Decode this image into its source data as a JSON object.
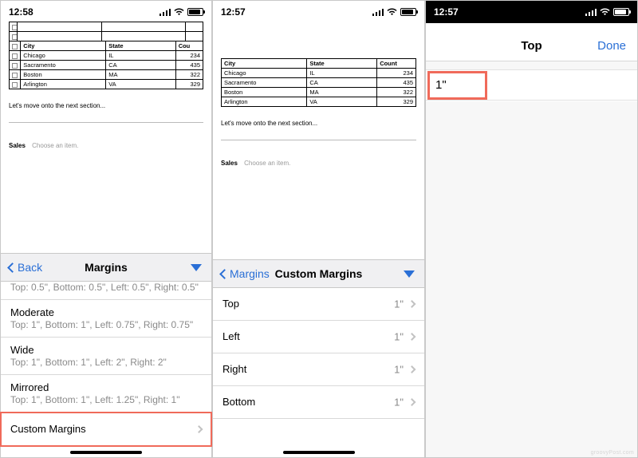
{
  "panel1": {
    "status_time": "12:58",
    "doc": {
      "table": {
        "headers": [
          "City",
          "State",
          "Count"
        ],
        "head_trunc": [
          "City",
          "State",
          "Cou"
        ],
        "rows": [
          {
            "city": "Chicago",
            "state": "IL",
            "count": 234
          },
          {
            "city": "Sacramento",
            "state": "CA",
            "count": 435
          },
          {
            "city": "Boston",
            "state": "MA",
            "count": 322
          },
          {
            "city": "Arlington",
            "state": "VA",
            "count": 329
          }
        ]
      },
      "section_text": "Let's move onto the next section...",
      "sales_label": "Sales",
      "sales_placeholder": "Choose an item."
    },
    "panel": {
      "back_label": "Back",
      "title": "Margins",
      "options": [
        {
          "name": "Top: 0.5\", Bottom: 0.5\", Left: 0.5\", Right: 0.5\"",
          "label": "",
          "truncated_sub_only": true
        },
        {
          "label": "Moderate",
          "sub": "Top: 1\", Bottom: 1\", Left: 0.75\", Right: 0.75\""
        },
        {
          "label": "Wide",
          "sub": "Top: 1\", Bottom: 1\", Left: 2\", Right: 2\""
        },
        {
          "label": "Mirrored",
          "sub": "Top: 1\", Bottom: 1\", Left: 1.25\", Right: 1\""
        },
        {
          "label": "Custom Margins"
        }
      ],
      "truncated_first_sub": "Top: 0.5\", Bottom: 0.5\", Left: 0.5\", Right: 0.5\""
    }
  },
  "panel2": {
    "status_time": "12:57",
    "panel": {
      "back_label": "Margins",
      "title": "Custom Margins",
      "fields": [
        {
          "label": "Top",
          "value": "1\""
        },
        {
          "label": "Left",
          "value": "1\""
        },
        {
          "label": "Right",
          "value": "1\""
        },
        {
          "label": "Bottom",
          "value": "1\""
        }
      ]
    }
  },
  "panel3": {
    "status_time": "12:57",
    "nav": {
      "title": "Top",
      "done": "Done"
    },
    "input_value": "1\"",
    "watermark": "groovyPost.com"
  },
  "colors": {
    "accent": "#2a6fd6",
    "highlight": "#f06a5a"
  }
}
